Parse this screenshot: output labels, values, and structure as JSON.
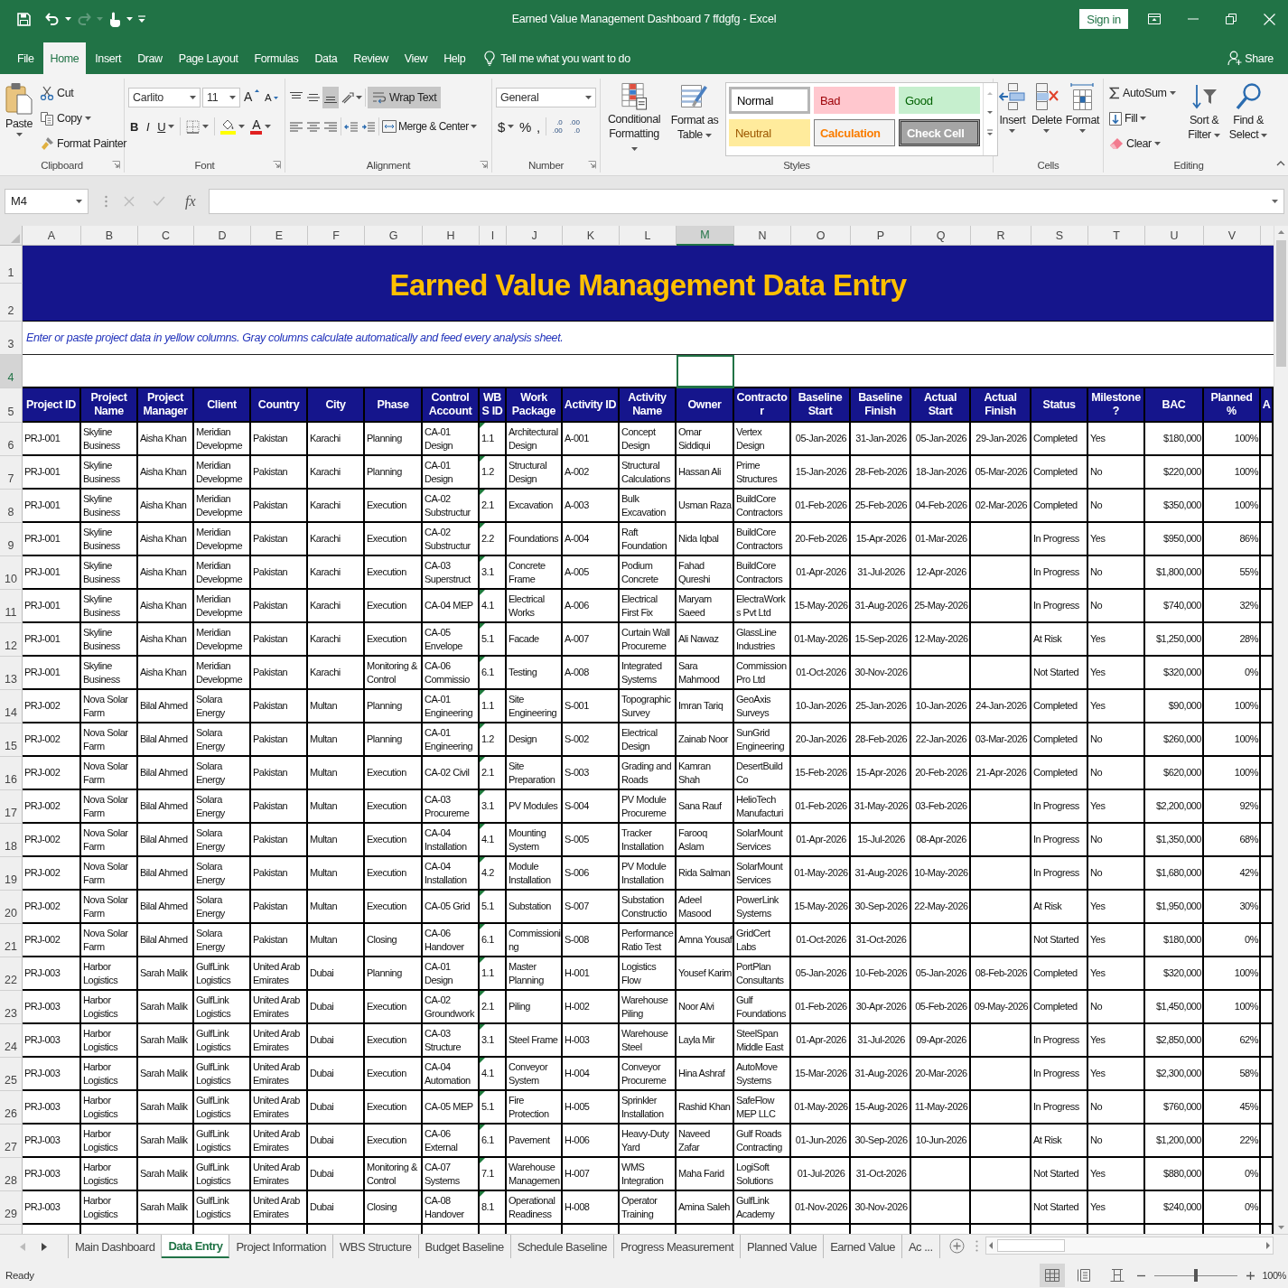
{
  "window": {
    "title": "Earned Value Management Dashboard 7 ffdgfg - Excel",
    "sign_in": "Sign in"
  },
  "ribbon_tabs": [
    {
      "label": "File",
      "selected": false
    },
    {
      "label": "Home",
      "selected": true
    },
    {
      "label": "Insert",
      "selected": false
    },
    {
      "label": "Draw",
      "selected": false
    },
    {
      "label": "Page Layout",
      "selected": false
    },
    {
      "label": "Formulas",
      "selected": false
    },
    {
      "label": "Data",
      "selected": false
    },
    {
      "label": "Review",
      "selected": false
    },
    {
      "label": "View",
      "selected": false
    },
    {
      "label": "Help",
      "selected": false
    }
  ],
  "tell_me": "Tell me what you want to do",
  "share": "Share",
  "ribbon": {
    "clipboard": {
      "label": "Clipboard",
      "paste": "Paste",
      "cut": "Cut",
      "copy": "Copy",
      "format_painter": "Format Painter"
    },
    "font": {
      "label": "Font",
      "family": "Carlito",
      "size": "11",
      "grow": "A",
      "shrink": "A",
      "bold": "B",
      "italic": "I",
      "underline": "U",
      "font_color": "A"
    },
    "alignment": {
      "label": "Alignment",
      "vertical": [
        {
          "selected": false
        },
        {
          "selected": false
        },
        {
          "selected": true
        }
      ],
      "wrap_text": {
        "label": "Wrap Text",
        "on": true
      },
      "merge_center": "Merge & Center"
    },
    "number": {
      "label": "Number",
      "format": "General",
      "currency": "$",
      "percent": "%",
      "comma": ",",
      "increase_decimal": [
        ".0",
        ".00"
      ],
      "decrease_decimal": [
        ".00",
        ".0"
      ]
    },
    "styles": {
      "label": "Styles",
      "conditional_formatting": "Conditional Formatting",
      "format_as_table": "Format as Table",
      "cell_styles": [
        {
          "label": "Normal",
          "kind": "normal",
          "selected": true
        },
        {
          "label": "Bad",
          "kind": "bad",
          "selected": false
        },
        {
          "label": "Good",
          "kind": "good",
          "selected": false
        },
        {
          "label": "Neutral",
          "kind": "neutral",
          "selected": false
        },
        {
          "label": "Calculation",
          "kind": "calculation",
          "selected": false
        },
        {
          "label": "Check Cell",
          "kind": "check",
          "selected": false
        }
      ]
    },
    "cells": {
      "label": "Cells",
      "insert": "Insert",
      "delete": "Delete",
      "format": "Format"
    },
    "editing": {
      "label": "Editing",
      "autosum": "AutoSum",
      "fill": "Fill",
      "clear": "Clear",
      "sort_filter": "Sort & Filter",
      "find_select": "Find & Select"
    }
  },
  "formula_bar": {
    "name_box": "M4",
    "function_label": "fx"
  },
  "sheet": {
    "column_letters": [
      {
        "label": "A",
        "selected": false
      },
      {
        "label": "B",
        "selected": false
      },
      {
        "label": "C",
        "selected": false
      },
      {
        "label": "D",
        "selected": false
      },
      {
        "label": "E",
        "selected": false
      },
      {
        "label": "F",
        "selected": false
      },
      {
        "label": "G",
        "selected": false
      },
      {
        "label": "H",
        "selected": false
      },
      {
        "label": "I",
        "selected": false
      },
      {
        "label": "J",
        "selected": false
      },
      {
        "label": "K",
        "selected": false
      },
      {
        "label": "L",
        "selected": false
      },
      {
        "label": "M",
        "selected": true
      },
      {
        "label": "N",
        "selected": false
      },
      {
        "label": "O",
        "selected": false
      },
      {
        "label": "P",
        "selected": false
      },
      {
        "label": "Q",
        "selected": false
      },
      {
        "label": "R",
        "selected": false
      },
      {
        "label": "S",
        "selected": false
      },
      {
        "label": "T",
        "selected": false
      },
      {
        "label": "U",
        "selected": false
      },
      {
        "label": "V",
        "selected": false
      }
    ],
    "row_numbers": [
      {
        "label": "1",
        "selected": false
      },
      {
        "label": "2",
        "selected": false
      },
      {
        "label": "3",
        "selected": false
      },
      {
        "label": "4",
        "selected": true
      },
      {
        "label": "5",
        "selected": false
      },
      {
        "label": "6",
        "selected": false
      },
      {
        "label": "7",
        "selected": false
      },
      {
        "label": "8",
        "selected": false
      },
      {
        "label": "9",
        "selected": false
      },
      {
        "label": "10",
        "selected": false
      },
      {
        "label": "11",
        "selected": false
      },
      {
        "label": "12",
        "selected": false
      },
      {
        "label": "13",
        "selected": false
      },
      {
        "label": "14",
        "selected": false
      },
      {
        "label": "15",
        "selected": false
      },
      {
        "label": "16",
        "selected": false
      },
      {
        "label": "17",
        "selected": false
      },
      {
        "label": "18",
        "selected": false
      },
      {
        "label": "19",
        "selected": false
      },
      {
        "label": "20",
        "selected": false
      },
      {
        "label": "21",
        "selected": false
      },
      {
        "label": "22",
        "selected": false
      },
      {
        "label": "23",
        "selected": false
      },
      {
        "label": "24",
        "selected": false
      },
      {
        "label": "25",
        "selected": false
      },
      {
        "label": "26",
        "selected": false
      },
      {
        "label": "27",
        "selected": false
      },
      {
        "label": "28",
        "selected": false
      },
      {
        "label": "29",
        "selected": false
      }
    ],
    "title": "Earned Value Management Data Entry",
    "note": "Enter or paste project data in yellow columns. Gray columns calculate automatically and feed every analysis sheet.",
    "columns": [
      {
        "label": "Project ID",
        "flag": false
      },
      {
        "label": "Project Name",
        "flag": false
      },
      {
        "label": "Project Manager",
        "flag": false
      },
      {
        "label": "Client",
        "flag": false
      },
      {
        "label": "Country",
        "flag": false
      },
      {
        "label": "City",
        "flag": false
      },
      {
        "label": "Phase",
        "flag": false
      },
      {
        "label": "Control Account",
        "flag": false
      },
      {
        "label": "WBS ID",
        "flag": true
      },
      {
        "label": "Work Package",
        "flag": false
      },
      {
        "label": "Activity ID",
        "flag": false
      },
      {
        "label": "Activity Name",
        "flag": false
      },
      {
        "label": "Owner",
        "flag": false
      },
      {
        "label": "Contractor",
        "flag": false
      },
      {
        "label": "Baseline Start",
        "flag": false
      },
      {
        "label": "Baseline Finish",
        "flag": false
      },
      {
        "label": "Actual Start",
        "flag": false
      },
      {
        "label": "Actual Finish",
        "flag": false
      },
      {
        "label": "Status",
        "flag": false
      },
      {
        "label": "Milestone?",
        "flag": false
      },
      {
        "label": "BAC",
        "flag": false
      },
      {
        "label": "Planned %",
        "flag": false
      },
      {
        "label": "A",
        "flag": false
      }
    ],
    "rows": [
      [
        "PRJ-001",
        "Skyline Business",
        "Aisha Khan",
        "Meridian Developme",
        "Pakistan",
        "Karachi",
        "Planning",
        "CA-01 Design",
        "1.1",
        "Architectural Design",
        "A-001",
        "Concept Design",
        "Omar Siddiqui",
        "Vertex Design",
        "05-Jan-2026",
        "31-Jan-2026",
        "05-Jan-2026",
        "29-Jan-2026",
        "Completed",
        "Yes",
        "$180,000",
        "100%"
      ],
      [
        "PRJ-001",
        "Skyline Business",
        "Aisha Khan",
        "Meridian Developme",
        "Pakistan",
        "Karachi",
        "Planning",
        "CA-01 Design",
        "1.2",
        "Structural Design",
        "A-002",
        "Structural Calculations",
        "Hassan Ali",
        "Prime Structures",
        "15-Jan-2026",
        "28-Feb-2026",
        "18-Jan-2026",
        "05-Mar-2026",
        "Completed",
        "No",
        "$220,000",
        "100%"
      ],
      [
        "PRJ-001",
        "Skyline Business",
        "Aisha Khan",
        "Meridian Developme",
        "Pakistan",
        "Karachi",
        "Execution",
        "CA-02 Substructur",
        "2.1",
        "Excavation",
        "A-003",
        "Bulk Excavation",
        "Usman Raza",
        "BuildCore Contractors",
        "01-Feb-2026",
        "25-Feb-2026",
        "04-Feb-2026",
        "02-Mar-2026",
        "Completed",
        "No",
        "$350,000",
        "100%"
      ],
      [
        "PRJ-001",
        "Skyline Business",
        "Aisha Khan",
        "Meridian Developme",
        "Pakistan",
        "Karachi",
        "Execution",
        "CA-02 Substructur",
        "2.2",
        "Foundations",
        "A-004",
        "Raft Foundation",
        "Nida Iqbal",
        "BuildCore Contractors",
        "20-Feb-2026",
        "15-Apr-2026",
        "01-Mar-2026",
        null,
        "In Progress",
        "Yes",
        "$950,000",
        "86%"
      ],
      [
        "PRJ-001",
        "Skyline Business",
        "Aisha Khan",
        "Meridian Developme",
        "Pakistan",
        "Karachi",
        "Execution",
        "CA-03 Superstruct",
        "3.1",
        "Concrete Frame",
        "A-005",
        "Podium Concrete",
        "Fahad Qureshi",
        "BuildCore Contractors",
        "01-Apr-2026",
        "31-Jul-2026",
        "12-Apr-2026",
        null,
        "In Progress",
        "No",
        "$1,800,000",
        "55%"
      ],
      [
        "PRJ-001",
        "Skyline Business",
        "Aisha Khan",
        "Meridian Developme",
        "Pakistan",
        "Karachi",
        "Execution",
        "CA-04 MEP",
        "4.1",
        "Electrical Works",
        "A-006",
        "Electrical First Fix",
        "Maryam Saeed",
        "ElectraWorks Pvt Ltd",
        "15-May-2026",
        "31-Aug-2026",
        "25-May-2026",
        null,
        "In Progress",
        "No",
        "$740,000",
        "32%"
      ],
      [
        "PRJ-001",
        "Skyline Business",
        "Aisha Khan",
        "Meridian Developme",
        "Pakistan",
        "Karachi",
        "Execution",
        "CA-05 Envelope",
        "5.1",
        "Facade",
        "A-007",
        "Curtain Wall Procureme",
        "Ali Nawaz",
        "GlassLine Industries",
        "01-May-2026",
        "15-Sep-2026",
        "12-May-2026",
        null,
        "At Risk",
        "Yes",
        "$1,250,000",
        "28%"
      ],
      [
        "PRJ-001",
        "Skyline Business",
        "Aisha Khan",
        "Meridian Developme",
        "Pakistan",
        "Karachi",
        "Monitoring & Control",
        "CA-06 Commissio",
        "6.1",
        "Testing",
        "A-008",
        "Integrated Systems",
        "Sara Mahmood",
        "CommissionPro Ltd",
        "01-Oct-2026",
        "30-Nov-2026",
        null,
        null,
        "Not Started",
        "Yes",
        "$320,000",
        "0%"
      ],
      [
        "PRJ-002",
        "Nova Solar Farm",
        "Bilal Ahmed",
        "Solara Energy",
        "Pakistan",
        "Multan",
        "Planning",
        "CA-01 Engineering",
        "1.1",
        "Site Engineering",
        "S-001",
        "Topographic Survey",
        "Imran Tariq",
        "GeoAxis Surveys",
        "10-Jan-2026",
        "25-Jan-2026",
        "10-Jan-2026",
        "24-Jan-2026",
        "Completed",
        "Yes",
        "$90,000",
        "100%"
      ],
      [
        "PRJ-002",
        "Nova Solar Farm",
        "Bilal Ahmed",
        "Solara Energy",
        "Pakistan",
        "Multan",
        "Planning",
        "CA-01 Engineering",
        "1.2",
        "Design",
        "S-002",
        "Electrical Design",
        "Zainab Noor",
        "SunGrid Engineering",
        "20-Jan-2026",
        "28-Feb-2026",
        "22-Jan-2026",
        "03-Mar-2026",
        "Completed",
        "No",
        "$260,000",
        "100%"
      ],
      [
        "PRJ-002",
        "Nova Solar Farm",
        "Bilal Ahmed",
        "Solara Energy",
        "Pakistan",
        "Multan",
        "Execution",
        "CA-02 Civil",
        "2.1",
        "Site Preparation",
        "S-003",
        "Grading and Roads",
        "Kamran Shah",
        "DesertBuild Co",
        "15-Feb-2026",
        "15-Apr-2026",
        "20-Feb-2026",
        "21-Apr-2026",
        "Completed",
        "No",
        "$620,000",
        "100%"
      ],
      [
        "PRJ-002",
        "Nova Solar Farm",
        "Bilal Ahmed",
        "Solara Energy",
        "Pakistan",
        "Multan",
        "Execution",
        "CA-03 Procureme",
        "3.1",
        "PV Modules",
        "S-004",
        "PV Module Procureme",
        "Sana Rauf",
        "HelioTech Manufacturi",
        "01-Feb-2026",
        "31-May-2026",
        "03-Feb-2026",
        null,
        "In Progress",
        "Yes",
        "$2,200,000",
        "92%"
      ],
      [
        "PRJ-002",
        "Nova Solar Farm",
        "Bilal Ahmed",
        "Solara Energy",
        "Pakistan",
        "Multan",
        "Execution",
        "CA-04 Installation",
        "4.1",
        "Mounting System",
        "S-005",
        "Tracker Installation",
        "Farooq Aslam",
        "SolarMount Services",
        "01-Apr-2026",
        "15-Jul-2026",
        "08-Apr-2026",
        null,
        "In Progress",
        "No",
        "$1,350,000",
        "68%"
      ],
      [
        "PRJ-002",
        "Nova Solar Farm",
        "Bilal Ahmed",
        "Solara Energy",
        "Pakistan",
        "Multan",
        "Execution",
        "CA-04 Installation",
        "4.2",
        "Module Installation",
        "S-006",
        "PV Module Installation",
        "Rida Salman",
        "SolarMount Services",
        "01-May-2026",
        "31-Aug-2026",
        "10-May-2026",
        null,
        "In Progress",
        "No",
        "$1,680,000",
        "42%"
      ],
      [
        "PRJ-002",
        "Nova Solar Farm",
        "Bilal Ahmed",
        "Solara Energy",
        "Pakistan",
        "Multan",
        "Execution",
        "CA-05 Grid",
        "5.1",
        "Substation",
        "S-007",
        "Substation Constructio",
        "Adeel Masood",
        "PowerLink Systems",
        "15-May-2026",
        "30-Sep-2026",
        "22-May-2026",
        null,
        "At Risk",
        "Yes",
        "$1,950,000",
        "30%"
      ],
      [
        "PRJ-002",
        "Nova Solar Farm",
        "Bilal Ahmed",
        "Solara Energy",
        "Pakistan",
        "Multan",
        "Closing",
        "CA-06 Handover",
        "6.1",
        "Commissioning",
        "S-008",
        "Performance Ratio Test",
        "Amna Yousaf",
        "GridCert Labs",
        "01-Oct-2026",
        "31-Oct-2026",
        null,
        null,
        "Not Started",
        "Yes",
        "$180,000",
        "0%"
      ],
      [
        "PRJ-003",
        "Harbor Logistics",
        "Sarah Malik",
        "GulfLink Logistics",
        "United Arab Emirates",
        "Dubai",
        "Planning",
        "CA-01 Design",
        "1.1",
        "Master Planning",
        "H-001",
        "Logistics Flow",
        "Yousef Karim",
        "PortPlan Consultants",
        "05-Jan-2026",
        "10-Feb-2026",
        "05-Jan-2026",
        "08-Feb-2026",
        "Completed",
        "Yes",
        "$320,000",
        "100%"
      ],
      [
        "PRJ-003",
        "Harbor Logistics",
        "Sarah Malik",
        "GulfLink Logistics",
        "United Arab Emirates",
        "Dubai",
        "Execution",
        "CA-02 Groundwork",
        "2.1",
        "Piling",
        "H-002",
        "Warehouse Piling",
        "Noor Alvi",
        "Gulf Foundations",
        "01-Feb-2026",
        "30-Apr-2026",
        "05-Feb-2026",
        "09-May-2026",
        "Completed",
        "No",
        "$1,450,000",
        "100%"
      ],
      [
        "PRJ-003",
        "Harbor Logistics",
        "Sarah Malik",
        "GulfLink Logistics",
        "United Arab Emirates",
        "Dubai",
        "Execution",
        "CA-03 Structure",
        "3.1",
        "Steel Frame",
        "H-003",
        "Warehouse Steel",
        "Layla Mir",
        "SteelSpan Middle East",
        "01-Apr-2026",
        "31-Jul-2026",
        "09-Apr-2026",
        null,
        "In Progress",
        "Yes",
        "$2,850,000",
        "62%"
      ],
      [
        "PRJ-003",
        "Harbor Logistics",
        "Sarah Malik",
        "GulfLink Logistics",
        "United Arab Emirates",
        "Dubai",
        "Execution",
        "CA-04 Automation",
        "4.1",
        "Conveyor System",
        "H-004",
        "Conveyor Procureme",
        "Hina Ashraf",
        "AutoMove Systems",
        "15-Mar-2026",
        "31-Aug-2026",
        "20-Mar-2026",
        null,
        "In Progress",
        "Yes",
        "$2,300,000",
        "58%"
      ],
      [
        "PRJ-003",
        "Harbor Logistics",
        "Sarah Malik",
        "GulfLink Logistics",
        "United Arab Emirates",
        "Dubai",
        "Execution",
        "CA-05 MEP",
        "5.1",
        "Fire Protection",
        "H-005",
        "Sprinkler Installation",
        "Rashid Khan",
        "SafeFlow MEP LLC",
        "01-May-2026",
        "15-Aug-2026",
        "11-May-2026",
        null,
        "In Progress",
        "No",
        "$760,000",
        "45%"
      ],
      [
        "PRJ-003",
        "Harbor Logistics",
        "Sarah Malik",
        "GulfLink Logistics",
        "United Arab Emirates",
        "Dubai",
        "Execution",
        "CA-06 External",
        "6.1",
        "Pavement",
        "H-006",
        "Heavy-Duty Yard",
        "Naveed Zafar",
        "Gulf Roads Contracting",
        "01-Jun-2026",
        "30-Sep-2026",
        "10-Jun-2026",
        null,
        "At Risk",
        "No",
        "$1,200,000",
        "22%"
      ],
      [
        "PRJ-003",
        "Harbor Logistics",
        "Sarah Malik",
        "GulfLink Logistics",
        "United Arab Emirates",
        "Dubai",
        "Monitoring & Control",
        "CA-07 Systems",
        "7.1",
        "Warehouse Managemen",
        "H-007",
        "WMS Integration",
        "Maha Farid",
        "LogiSoft Solutions",
        "01-Jul-2026",
        "31-Oct-2026",
        null,
        null,
        "Not Started",
        "Yes",
        "$880,000",
        "0%"
      ],
      [
        "PRJ-003",
        "Harbor Logistics",
        "Sarah Malik",
        "GulfLink Logistics",
        "United Arab Emirates",
        "Dubai",
        "Closing",
        "CA-08 Handover",
        "8.1",
        "Operational Readiness",
        "H-008",
        "Operator Training",
        "Amina Saleh",
        "GulfLink Academy",
        "01-Nov-2026",
        "30-Nov-2026",
        null,
        null,
        "Not Started",
        "Yes",
        "$240,000",
        "0%"
      ]
    ]
  },
  "sheet_tabs": [
    {
      "label": "Main Dashboard",
      "selected": false
    },
    {
      "label": "Data Entry",
      "selected": true
    },
    {
      "label": "Project Information",
      "selected": false
    },
    {
      "label": "WBS Structure",
      "selected": false
    },
    {
      "label": "Budget Baseline",
      "selected": false
    },
    {
      "label": "Schedule Baseline",
      "selected": false
    },
    {
      "label": "Progress Measurement",
      "selected": false
    },
    {
      "label": "Planned Value",
      "selected": false
    },
    {
      "label": "Earned Value",
      "selected": false
    },
    {
      "label": "Ac ...",
      "selected": false
    }
  ],
  "status_bar": {
    "text": "Ready",
    "views": [
      {
        "selected": true
      },
      {
        "selected": false
      },
      {
        "selected": false
      }
    ],
    "zoom": {
      "level": 0.5,
      "reading": "100%"
    }
  }
}
